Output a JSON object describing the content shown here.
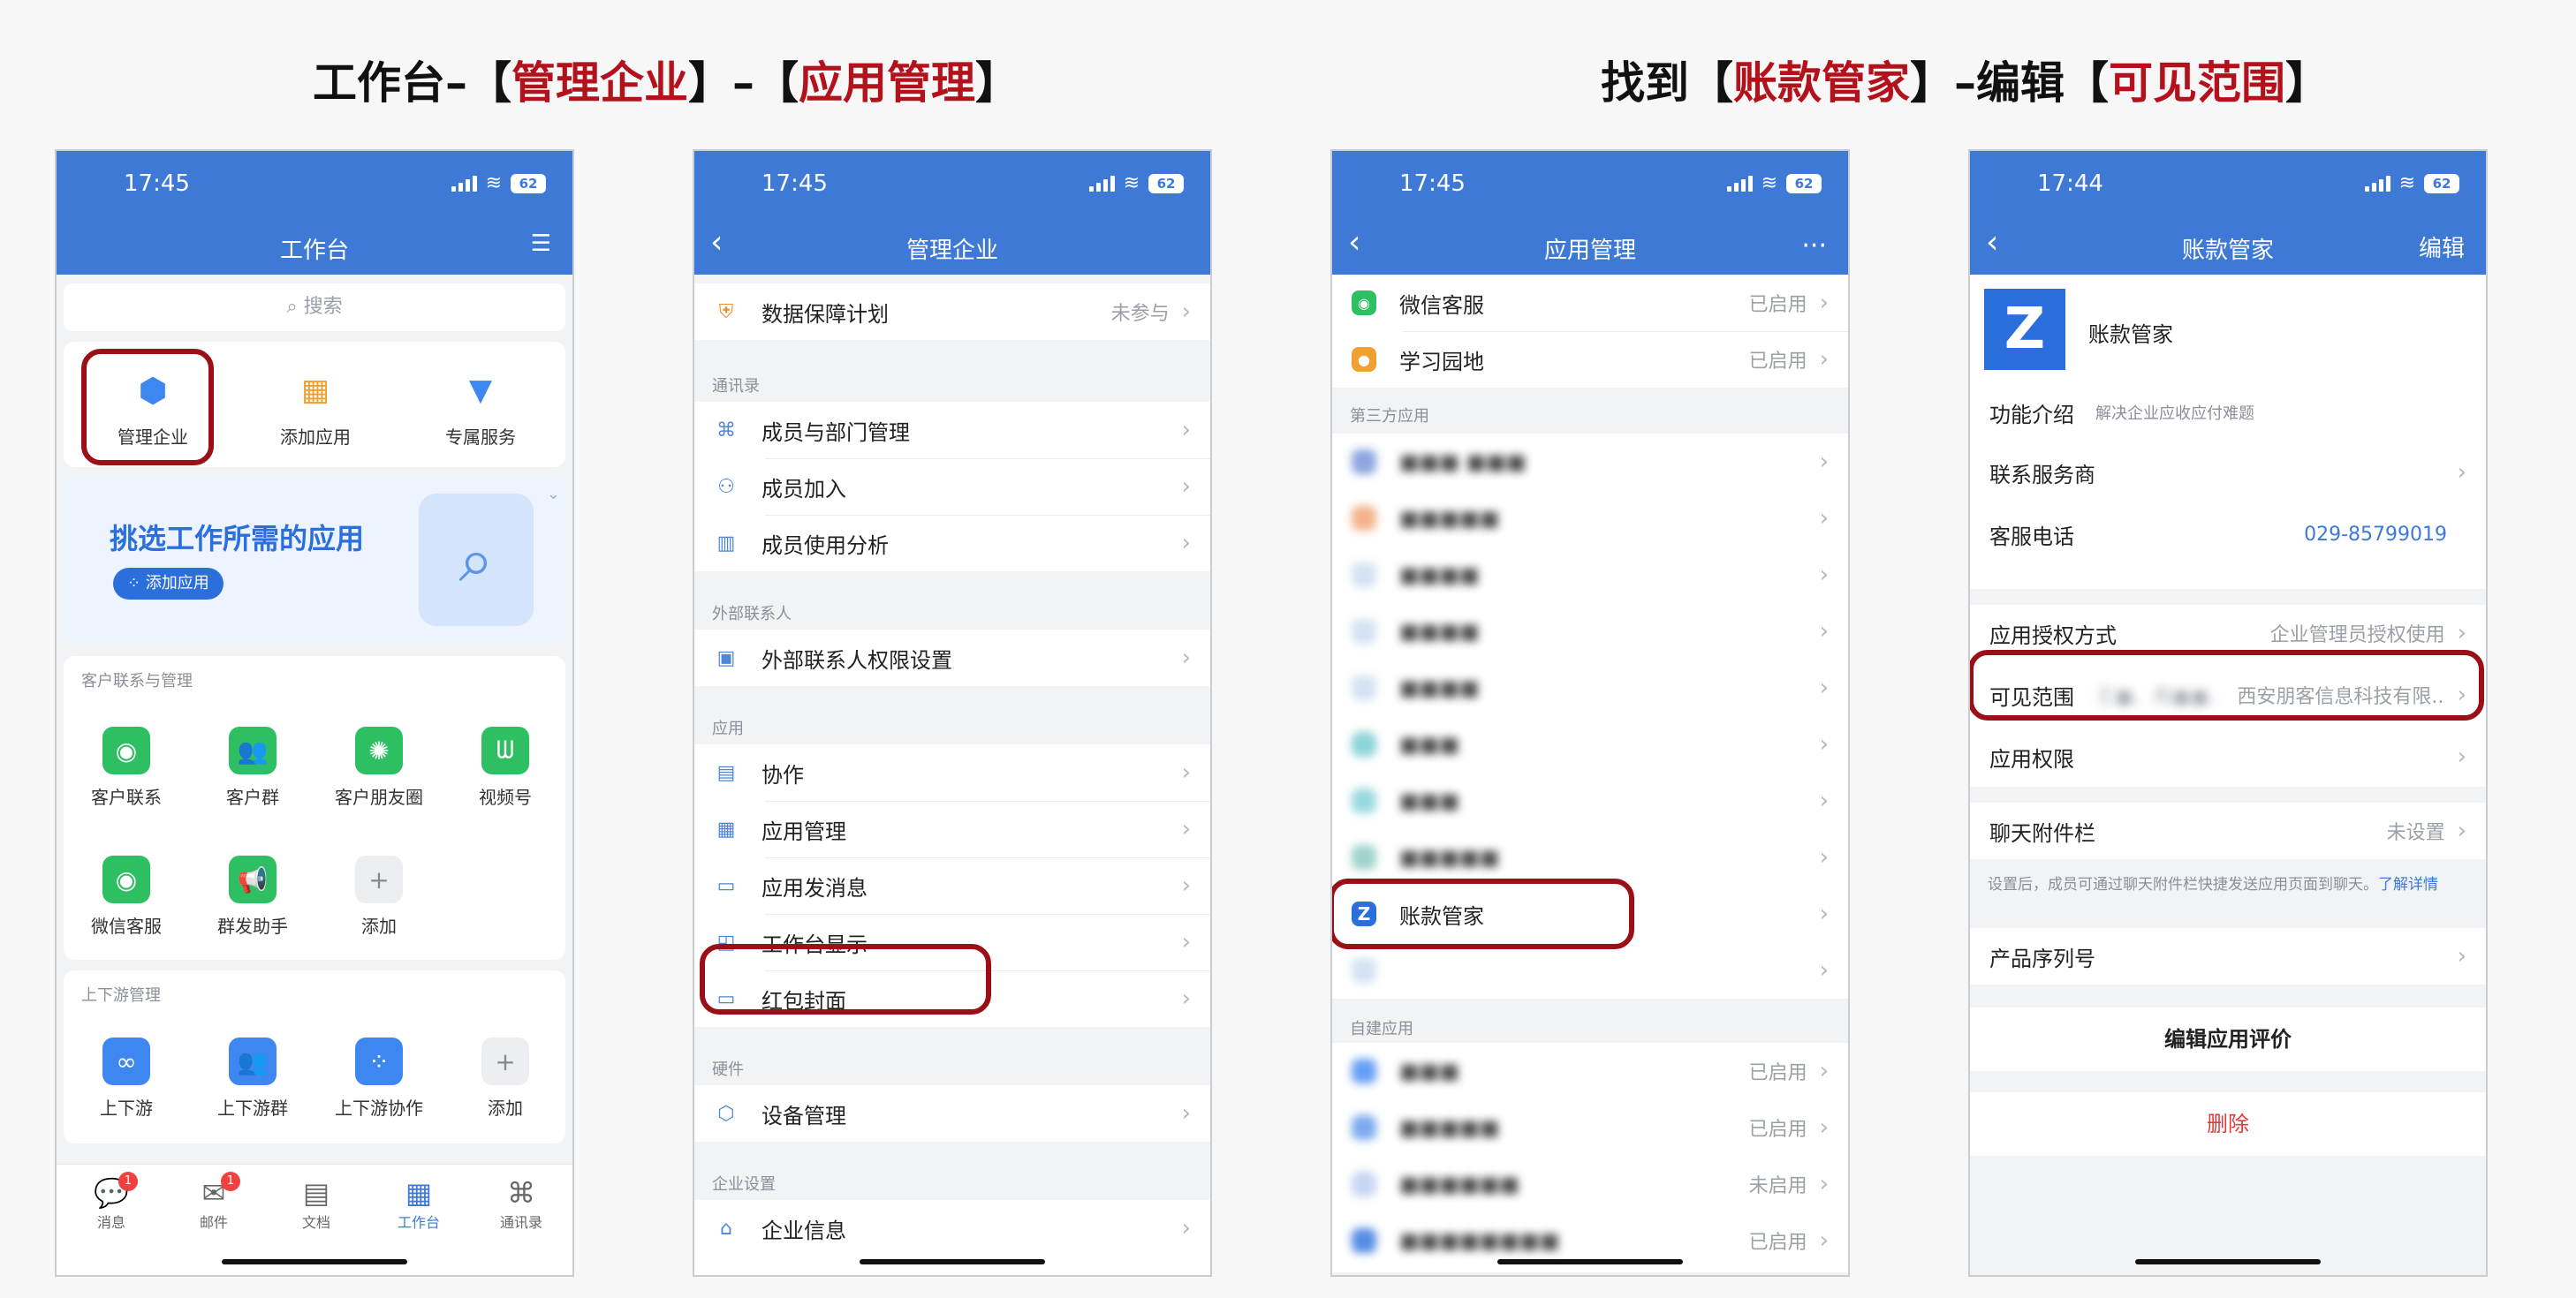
{
  "captions": {
    "left": [
      "工作台–【",
      "管理企业",
      "】–【",
      "应用管理",
      "】"
    ],
    "right": [
      "找到【",
      "账款管家",
      "】–编辑【",
      "可见范围",
      "】"
    ]
  },
  "phone1": {
    "time": "17:45",
    "battery": "62",
    "title": "工作台",
    "search": "搜索",
    "top_items": [
      "管理企业",
      "添加应用",
      "专属服务"
    ],
    "banner": {
      "text": "挑选工作所需的应用",
      "button": "添加应用"
    },
    "section1": {
      "label": "客户联系与管理",
      "items": [
        "客户联系",
        "客户群",
        "客户朋友圈",
        "视频号",
        "微信客服",
        "群发助手",
        "添加"
      ]
    },
    "section2": {
      "label": "上下游管理",
      "items": [
        "上下游",
        "上下游群",
        "上下游协作",
        "添加"
      ]
    },
    "tabs": [
      {
        "label": "消息",
        "badge": "1"
      },
      {
        "label": "邮件",
        "badge": "1"
      },
      {
        "label": "文档"
      },
      {
        "label": "工作台"
      },
      {
        "label": "通讯录"
      }
    ]
  },
  "phone2": {
    "time": "17:45",
    "battery": "62",
    "title": "管理企业",
    "top_row": {
      "label": "数据保障计划",
      "value": "未参与"
    },
    "sections": [
      {
        "label": "通讯录",
        "rows": [
          "成员与部门管理",
          "成员加入",
          "成员使用分析"
        ]
      },
      {
        "label": "外部联系人",
        "rows": [
          "外部联系人权限设置"
        ]
      },
      {
        "label": "应用",
        "rows": [
          "协作",
          "应用管理",
          "应用发消息",
          "工作台显示",
          "红包封面"
        ]
      },
      {
        "label": "硬件",
        "rows": [
          "设备管理"
        ]
      },
      {
        "label": "企业设置",
        "rows": [
          "企业信息"
        ]
      }
    ]
  },
  "phone3": {
    "time": "17:45",
    "battery": "62",
    "title": "应用管理",
    "more": "···",
    "top_rows": [
      {
        "label": "微信客服",
        "value": "已启用"
      },
      {
        "label": "学习园地",
        "value": "已启用"
      }
    ],
    "third_party_label": "第三方应用",
    "blurred_rows": [
      "■■■ ■■■",
      "■■■■■",
      "■■■■",
      "■■■■",
      "■■■■",
      "■■■",
      "■■■",
      "■■■■■"
    ],
    "target_app": "账款管家",
    "self_built_label": "自建应用",
    "self_built_rows": [
      {
        "label": "■■■",
        "value": "已启用"
      },
      {
        "label": "■■■■■",
        "value": "已启用"
      },
      {
        "label": "■■■■■■",
        "value": "未启用"
      },
      {
        "label": "■■■■■■■■",
        "value": "已启用"
      }
    ]
  },
  "phone4": {
    "time": "17:44",
    "battery": "62",
    "title": "账款管家",
    "edit": "编辑",
    "app_name": "账款管家",
    "app_logo": "Z",
    "intro": {
      "label": "功能介绍",
      "value": "解决企业应收应付难题"
    },
    "provider": "联系服务商",
    "phone": {
      "label": "客服电话",
      "value": "029-85799019"
    },
    "auth": {
      "label": "应用授权方式",
      "value": "企业管理员授权使用"
    },
    "visible": {
      "label": "可见范围",
      "hidden": "王■、周■■、",
      "value": "西安朋客信息科技有限..."
    },
    "permission": "应用权限",
    "attach": {
      "label": "聊天附件栏",
      "value": "未设置"
    },
    "attach_note": "设置后，成员可通过聊天附件栏快捷发送应用页面到聊天。",
    "attach_link": "了解详情",
    "serial": "产品序列号",
    "review": "编辑应用评价",
    "delete": "删除",
    "delete_color": "#e03a3a"
  },
  "colors": {
    "accent": "#3e79d6",
    "highlight": "#9b1016",
    "caption_red": "#b3121c"
  }
}
